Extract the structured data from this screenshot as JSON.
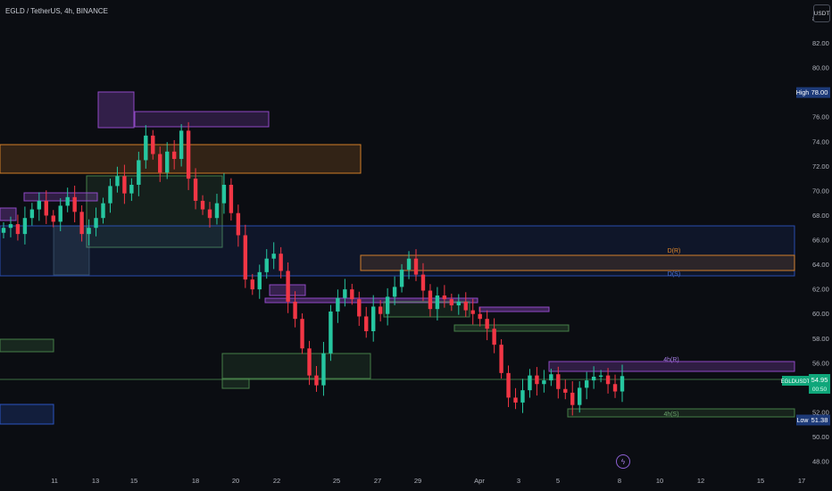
{
  "header": {
    "title": "EGLD / TetherUS, 4h, BINANCE",
    "currency_button": "USDT"
  },
  "colors": {
    "background": "#0b0d12",
    "up": "#26c6a0",
    "down": "#f23645",
    "orange_zone": "#e58a2a",
    "purple_zone": "#9c4fd6",
    "green_zone": "#4b8a4e",
    "blue_zone": "#2f5bd3"
  },
  "price_axis": {
    "ticks": [
      "48.00",
      "50.00",
      "52.00",
      "54.00",
      "56.00",
      "58.00",
      "60.00",
      "62.00",
      "64.00",
      "66.00",
      "68.00",
      "70.00",
      "72.00",
      "74.00",
      "76.00",
      "78.00",
      "80.00",
      "82.00",
      "84.00"
    ]
  },
  "time_axis": {
    "ticks": [
      "11",
      "13",
      "15",
      "18",
      "20",
      "22",
      "25",
      "27",
      "29",
      "Apr",
      "3",
      "5",
      "8",
      "10",
      "12",
      "15",
      "17"
    ]
  },
  "badges": {
    "high_label": "High",
    "high_value": "78.00",
    "low_label": "Low",
    "low_value": "51.38",
    "symbol": "EGLDUSDT",
    "price": "54.95",
    "countdown": "00:50"
  },
  "zone_labels": {
    "d_r": "D(R)",
    "d_s": "D(S)",
    "h4_r": "4h(R)",
    "h4_s": "4h(S)"
  },
  "bolt_icon": "lightning-icon",
  "chart_data": {
    "type": "candlestick",
    "title": "EGLD / TetherUS, 4h, BINANCE",
    "ylim": [
      47.0,
      85.0
    ],
    "y_scale": "linear",
    "x_ticks": [
      "11",
      "13",
      "15",
      "18",
      "20",
      "22",
      "25",
      "27",
      "29",
      "Apr",
      "3",
      "5",
      "8",
      "10",
      "12",
      "15",
      "17"
    ],
    "approx_closes": [
      67.0,
      67.3,
      66.5,
      67.8,
      68.5,
      69.2,
      68.0,
      67.5,
      68.8,
      69.5,
      68.3,
      66.5,
      67.0,
      67.8,
      69.0,
      70.4,
      71.2,
      69.8,
      70.5,
      72.5,
      74.5,
      73.0,
      71.5,
      73.2,
      72.6,
      74.9,
      71.0,
      69.2,
      68.5,
      67.8,
      69.0,
      70.5,
      68.2,
      66.4,
      62.8,
      62.0,
      63.4,
      64.5,
      64.9,
      63.5,
      61.0,
      59.6,
      57.2,
      55.0,
      54.2,
      56.8,
      60.2,
      61.3,
      62.0,
      61.2,
      59.8,
      58.6,
      60.6,
      60.0,
      61.4,
      62.2,
      63.6,
      64.5,
      63.2,
      61.9,
      60.4,
      61.5,
      61.2,
      60.7,
      61.0,
      60.3,
      60.0,
      59.6,
      58.8,
      57.5,
      55.2,
      53.2,
      52.8,
      53.8,
      55.0,
      54.3,
      54.6,
      55.1,
      53.9,
      53.6,
      52.6,
      54.0,
      54.6,
      54.9,
      55.0,
      54.3,
      53.7,
      54.95
    ],
    "levels": [
      {
        "label": "D(R)",
        "low": 63.5,
        "high": 64.8
      },
      {
        "label": "D(S)",
        "low": 63.0,
        "high": 67.0
      },
      {
        "label": "4h(R)",
        "low": 55.2,
        "high": 55.8
      },
      {
        "label": "4h(S)",
        "low": 51.9,
        "high": 52.3
      }
    ],
    "high": 78.0,
    "low": 51.38,
    "last_price": 54.95
  }
}
